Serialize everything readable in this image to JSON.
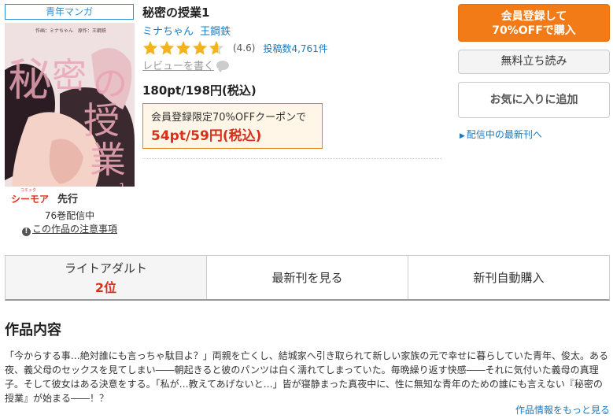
{
  "product": {
    "genre_tag": "青年マンガ",
    "title": "秘密の授業1",
    "authors": [
      "ミナちゃん",
      "王鋼鉄"
    ],
    "rating": 4.6,
    "rating_text": "(4.6)",
    "review_count_text": "投稿数4,761件",
    "write_review": "レビューを書く",
    "price_text": "180pt/198円(税込)",
    "coupon_label": "会員登録限定70%OFFクーポンで",
    "coupon_price": "54pt/59円(税込)",
    "volume_count": "76巻配信中",
    "caution_icon": "!",
    "caution_link": "この作品の注意事項"
  },
  "cover": {
    "title_chars": [
      "秘",
      "密",
      "の",
      "授",
      "業"
    ],
    "credit_line": "作画：ミナちゃん　原作：王鋼鉄",
    "volume_mark": "1",
    "badge_small": "コミック",
    "badge_brand": "シーモア",
    "badge_tag": "先行"
  },
  "actions": {
    "register_line1": "会員登録して",
    "register_line2": "70%OFFで購入",
    "trial": "無料立ち読み",
    "favorite": "お気に入りに追加",
    "latest_arrow": "▶",
    "latest": "配信中の最新刊へ"
  },
  "tabs": {
    "rank_label": "ライトアダルト",
    "rank_value": "2位",
    "latest_tab": "最新刊を見る",
    "auto_buy": "新刊自動購入"
  },
  "content": {
    "section_title": "作品内容",
    "description": "「今からする事…絶対誰にも言っちゃ駄目よ？」両親を亡くし、結城家へ引き取られて新しい家族の元で幸せに暮らしていた青年、俊太。ある夜、義父母のセックスを見てしまい――朝起きると彼のパンツは白く濡れてしまっていた。毎晩繰り返す快感――それに気付いた義母の真理子。そして彼女はある決意をする。「私が…教えてあげないと…」皆が寝静まった真夜中に、性に無知な青年のための誰にも言えない『秘密の授業』が始まる――！？",
    "more_link": "作品情報をもっと見る"
  },
  "colors": {
    "accent_orange": "#f27a17",
    "link_blue": "#1a7abf",
    "price_red": "#d8301a",
    "star_gold": "#f3b31b"
  }
}
